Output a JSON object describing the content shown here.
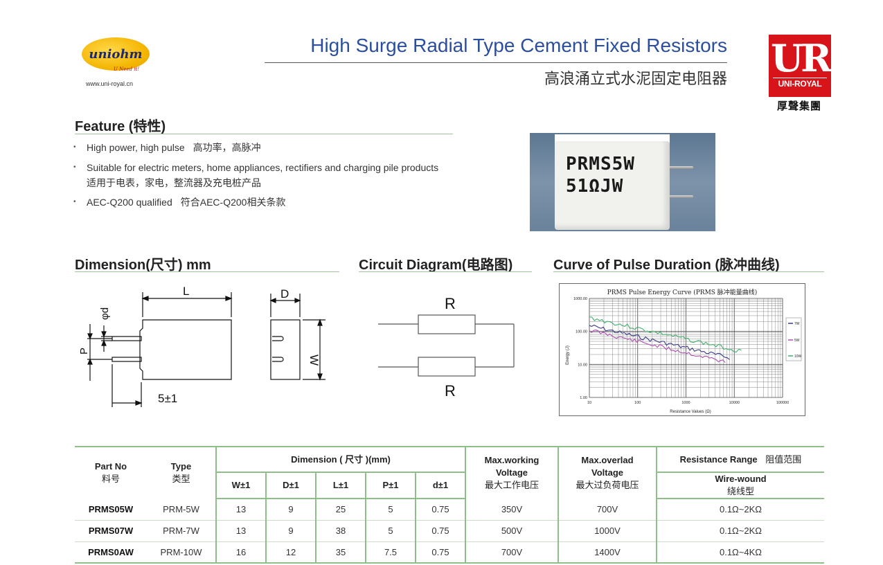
{
  "brand": {
    "logo_text": "uniohm",
    "slogan": "U Need it!",
    "url": "www.uni-royal.cn",
    "right_logo_mark": "UR",
    "right_logo_name": "UNI-ROYAL",
    "right_logo_cn": "厚聲集團",
    "red": "#d7141a",
    "yellow": "#f4b400"
  },
  "title": {
    "en": "High Surge Radial Type Cement Fixed Resistors",
    "cn": "高浪涌立式水泥固定电阻器",
    "color": "#2b4f9e"
  },
  "feature": {
    "heading": "Feature (特性)",
    "items": [
      {
        "en": "High power, high pulse",
        "cn": "高功率，高脉冲"
      },
      {
        "en": "Suitable for electric meters, home appliances, rectifiers and charging pile products",
        "cn": "适用于电表，家电，整流器及充电桩产品"
      },
      {
        "en": "AEC-Q200 qualified",
        "cn": "符合AEC-Q200相关条款"
      }
    ]
  },
  "photo": {
    "line1": "PRMS5W",
    "line2": "51ΩJW"
  },
  "dimension": {
    "heading": "Dimension(尺寸) mm",
    "labels": {
      "L": "L",
      "D": "D",
      "W": "W",
      "P": "P",
      "phid": "φd",
      "pin_len": "5±1"
    }
  },
  "circuit": {
    "heading": "Circuit Diagram(电路图)",
    "label_top": "R",
    "label_bottom": "R"
  },
  "curve": {
    "heading": "Curve of Pulse Duration (脉冲曲线)",
    "chart_title": "PRMS Pulse Energy Curve (PRMS 脉冲能量曲线)",
    "xlabel": "Resistance Values (Ω)",
    "ylabel": "Energy (J)",
    "x_ticks": [
      "10",
      "100",
      "1000",
      "10000",
      "100000"
    ],
    "y_ticks": [
      "1000.00",
      "100.00",
      "10.00",
      "1.00"
    ],
    "legend": [
      "7W",
      "5W",
      "10W"
    ],
    "colors": {
      "7W": "#3a3a8c",
      "5W": "#b04cb0",
      "10W": "#3fae6a"
    }
  },
  "table": {
    "headers": {
      "part_no": "Part No",
      "part_no_cn": "料号",
      "type": "Type",
      "type_cn": "类型",
      "dimension": "Dimension ( 尺寸 )(mm)",
      "w": "W±1",
      "d": "D±1",
      "l": "L±1",
      "p": "P±1",
      "dd": "d±1",
      "max_work": "Max.working",
      "max_work2": "Voltage",
      "max_work_cn": "最大工作电压",
      "max_over": "Max.overlad",
      "max_over2": "Voltage",
      "max_over_cn": "最大过负荷电压",
      "range": "Resistance Range",
      "range_cn": "阻值范围",
      "wire": "Wire-wound",
      "wire_cn": "绕线型"
    },
    "rows": [
      {
        "part": "PRMS05W",
        "type": "PRM-5W",
        "w": "13",
        "d": "9",
        "l": "25",
        "p": "5",
        "dd": "0.75",
        "work": "350V",
        "over": "700V",
        "range": "0.1Ω~2KΩ"
      },
      {
        "part": "PRMS07W",
        "type": "PRM-7W",
        "w": "13",
        "d": "9",
        "l": "38",
        "p": "5",
        "dd": "0.75",
        "work": "500V",
        "over": "1000V",
        "range": "0.1Ω~2KΩ"
      },
      {
        "part": "PRMS0AW",
        "type": "PRM-10W",
        "w": "16",
        "d": "12",
        "l": "35",
        "p": "7.5",
        "dd": "0.75",
        "work": "700V",
        "over": "1400V",
        "range": "0.1Ω~4KΩ"
      }
    ]
  }
}
